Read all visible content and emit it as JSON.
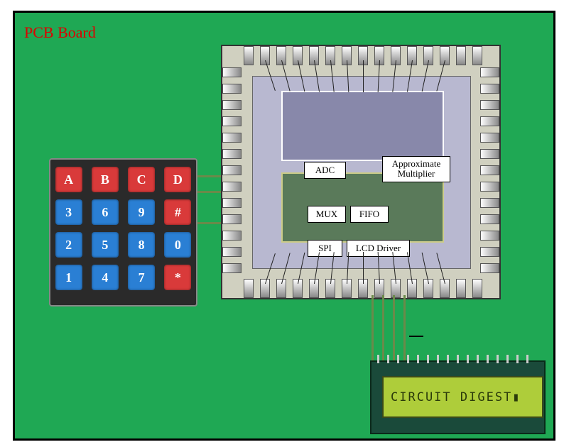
{
  "title": "PCB Board",
  "keypad": {
    "rows": [
      [
        {
          "t": "A",
          "c": "kr"
        },
        {
          "t": "B",
          "c": "kr"
        },
        {
          "t": "C",
          "c": "kr"
        },
        {
          "t": "D",
          "c": "kr"
        }
      ],
      [
        {
          "t": "3",
          "c": "kb"
        },
        {
          "t": "6",
          "c": "kb"
        },
        {
          "t": "9",
          "c": "kb"
        },
        {
          "t": "#",
          "c": "kr"
        }
      ],
      [
        {
          "t": "2",
          "c": "kb"
        },
        {
          "t": "5",
          "c": "kb"
        },
        {
          "t": "8",
          "c": "kb"
        },
        {
          "t": "0",
          "c": "kb"
        }
      ],
      [
        {
          "t": "1",
          "c": "kb"
        },
        {
          "t": "4",
          "c": "kb"
        },
        {
          "t": "7",
          "c": "kb"
        },
        {
          "t": "*",
          "c": "kr"
        }
      ]
    ]
  },
  "chip": {
    "blocks": {
      "adc": "ADC",
      "approx": "Approximate\nMultiplier",
      "mux": "MUX",
      "fifo": "FIFO",
      "spi": "SPI",
      "lcd": "LCD Driver"
    }
  },
  "lcd": {
    "text": "CIRCUIT DIGEST▮"
  },
  "chart_data": {
    "type": "diagram",
    "title": "PCB Board",
    "components": [
      {
        "name": "Keypad 4x4",
        "keys": [
          "A",
          "B",
          "C",
          "D",
          "3",
          "6",
          "9",
          "#",
          "2",
          "5",
          "8",
          "0",
          "1",
          "4",
          "7",
          "*"
        ]
      },
      {
        "name": "IC Chip",
        "blocks": [
          "ADC",
          "Approximate Multiplier",
          "MUX",
          "FIFO",
          "SPI",
          "LCD Driver"
        ]
      },
      {
        "name": "LCD Module",
        "display": "CIRCUIT DIGEST"
      }
    ],
    "connections": [
      {
        "from": "Keypad",
        "to": "Chip"
      },
      {
        "from": "Chip",
        "to": "LCD Module"
      }
    ]
  }
}
